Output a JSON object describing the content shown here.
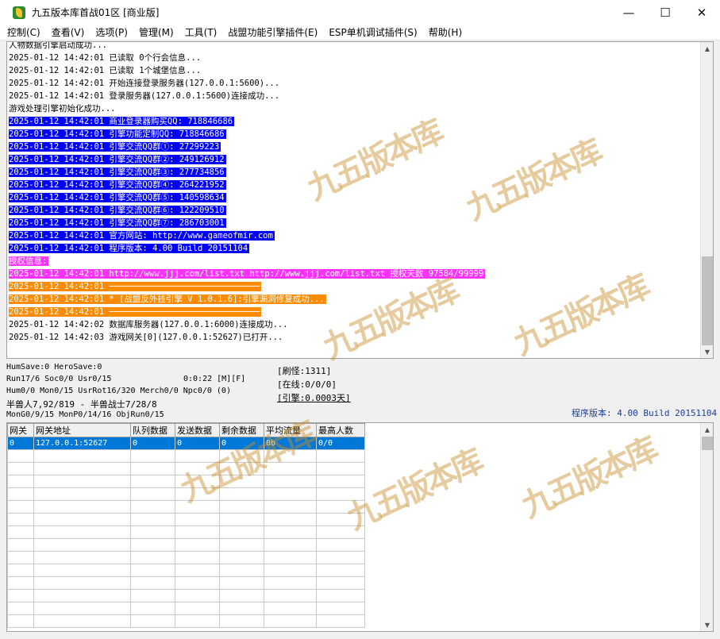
{
  "window": {
    "title": "九五版本库首战01区 [商业版]",
    "controls": [
      "—",
      "☐",
      "✕"
    ]
  },
  "menu": [
    "控制(C)",
    "查看(V)",
    "选项(P)",
    "管理(M)",
    "工具(T)",
    "战盟功能引擎插件(E)",
    "ESP单机调试插件(S)",
    "帮助(H)"
  ],
  "log": [
    {
      "text": "人物数据引擎启动成功...",
      "style": "plain"
    },
    {
      "text": "2025-01-12 14:42:01 已读取 0个行会信息...",
      "style": "plain"
    },
    {
      "text": "2025-01-12 14:42:01 已读取 1个城堡信息...",
      "style": "plain"
    },
    {
      "text": "2025-01-12 14:42:01 开始连接登录服务器(127.0.0.1:5600)...",
      "style": "plain"
    },
    {
      "text": "2025-01-12 14:42:01 登录服务器(127.0.0.1:5600)连接成功...",
      "style": "plain"
    },
    {
      "text": "游戏处理引擎初始化成功...",
      "style": "plain"
    },
    {
      "text": "2025-01-12 14:42:01 商业登录器购买QQ: 718846686",
      "style": "blue"
    },
    {
      "text": "2025-01-12 14:42:01 引擎功能定制QQ: 718846686",
      "style": "blue"
    },
    {
      "text": "2025-01-12 14:42:01 引擎交流QQ群①: 27299223",
      "style": "blue"
    },
    {
      "text": "2025-01-12 14:42:01 引擎交流QQ群②: 249126912",
      "style": "blue"
    },
    {
      "text": "2025-01-12 14:42:01 引擎交流QQ群③: 277734856",
      "style": "blue"
    },
    {
      "text": "2025-01-12 14:42:01 引擎交流QQ群④: 264221952",
      "style": "blue"
    },
    {
      "text": "2025-01-12 14:42:01 引擎交流QQ群⑤: 140598634",
      "style": "blue"
    },
    {
      "text": "2025-01-12 14:42:01 引擎交流QQ群⑥: 122209510",
      "style": "blue"
    },
    {
      "text": "2025-01-12 14:42:01 引擎交流QQ群⑦: 286703001",
      "style": "blue"
    },
    {
      "text": "2025-01-12 14:42:01 官方网站: http://www.gameofmir.com",
      "style": "blue"
    },
    {
      "text": "2025-01-12 14:42:01 程序版本: 4.00 Build 20151104",
      "style": "blue"
    },
    {
      "text": "授权信息:",
      "style": "magenta"
    },
    {
      "text": "2025-01-12 14:42:01 http://www.jjj.com/list.txt http://www.jjj.com/list.txt 授权天数 97584/99999",
      "style": "magenta"
    },
    {
      "text": "2025-01-12 14:42:01 ──────────────────────────────",
      "style": "orange"
    },
    {
      "text": "2025-01-12 14:42:01 * [战盟反外挂引擎 V 1.0.1.6]:引擎漏洞修复成功...",
      "style": "orange"
    },
    {
      "text": "2025-01-12 14:42:01 ──────────────────────────────",
      "style": "orange"
    },
    {
      "text": "2025-01-12 14:42:02 数据库服务器(127.0.0.1:6000)连接成功...",
      "style": "plain"
    },
    {
      "text": "2025-01-12 14:42:03 游戏网关[0](127.0.0.1:52627)已打开...",
      "style": "plain"
    }
  ],
  "status": {
    "line1": "HumSave:0 HeroSave:0",
    "line2": "Run17/6 Soc0/0 Usr0/15",
    "timer": "0:0:22 [M][F]",
    "line3": "Hum0/0 Mon0/15 UsrRot16/320 Merch0/0 Npc0/0 (0)",
    "line4": "半兽人7,92/819 - 半兽战士7/28/8",
    "line5": "MonG0/9/15 MonP0/14/16 ObjRun0/15",
    "refresh": "[刷怪:1311]",
    "online": "[在线:0/0/0]",
    "engine": "[引擎:0.0003天]",
    "version": "程序版本: 4.00 Build 20151104"
  },
  "grid": {
    "headers": [
      "网关",
      "网关地址",
      "队列数据",
      "发送数据",
      "剩余数据",
      "平均流量",
      "最高人数"
    ],
    "rows": [
      [
        "0",
        "127.0.0.1:52627",
        "0",
        "0",
        "0",
        "0b",
        "0/0"
      ]
    ]
  },
  "watermark": "九五版本库"
}
